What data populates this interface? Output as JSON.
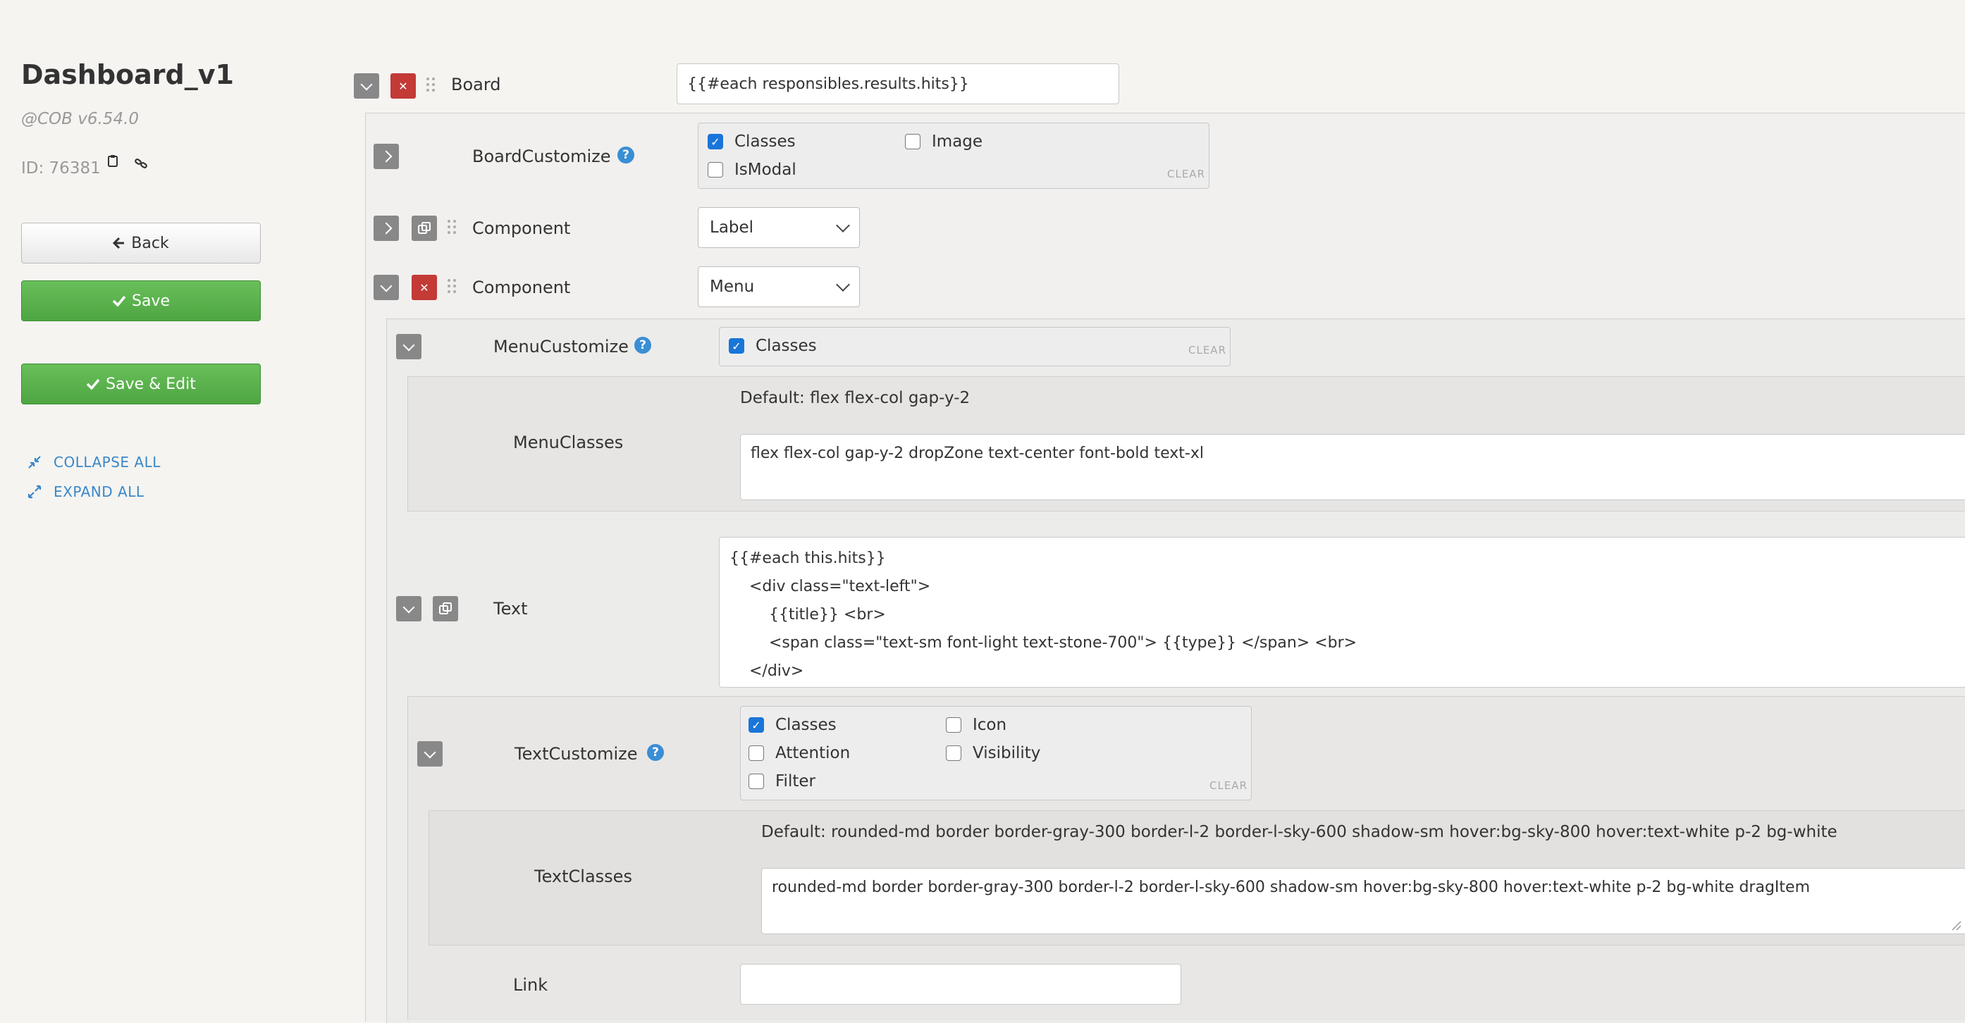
{
  "sidebar": {
    "title": "Dashboard_v1",
    "version": "@COB v6.54.0",
    "id_text": "ID: 76381",
    "copy_icon": "clipboard-icon",
    "link_icon": "link-icon",
    "back_label": "Back",
    "save_label": "Save",
    "save_edit_label": "Save & Edit",
    "collapse_all": "COLLAPSE ALL",
    "expand_all": "EXPAND ALL"
  },
  "form": {
    "board": {
      "label": "Board",
      "value": "{{#each responsibles.results.hits}}"
    },
    "board_customize": {
      "label": "BoardCustomize",
      "options": [
        {
          "label": "Classes",
          "checked": true
        },
        {
          "label": "Image",
          "checked": false
        },
        {
          "label": "IsModal",
          "checked": false
        }
      ],
      "clear": "CLEAR"
    },
    "component1": {
      "label": "Component",
      "value": "Label"
    },
    "component2": {
      "label": "Component",
      "value": "Menu"
    },
    "menu_customize": {
      "label": "MenuCustomize",
      "options": [
        {
          "label": "Classes",
          "checked": true
        }
      ],
      "clear": "CLEAR"
    },
    "menu_classes": {
      "label": "MenuClasses",
      "default": "Default: flex flex-col gap-y-2",
      "value": "flex flex-col gap-y-2 dropZone text-center font-bold text-xl"
    },
    "text": {
      "label": "Text",
      "lines": [
        "{{#each this.hits}}",
        "    <div class=\"text-left\">",
        "        {{title}} <br>",
        "        <span class=\"text-sm font-light text-stone-700\"> {{type}} </span> <br>",
        "    </div>"
      ]
    },
    "text_customize": {
      "label": "TextCustomize",
      "options": [
        {
          "label": "Classes",
          "checked": true
        },
        {
          "label": "Icon",
          "checked": false
        },
        {
          "label": "Attention",
          "checked": false
        },
        {
          "label": "Visibility",
          "checked": false
        },
        {
          "label": "Filter",
          "checked": false
        }
      ],
      "clear": "CLEAR"
    },
    "text_classes": {
      "label": "TextClasses",
      "default": "Default: rounded-md border border-gray-300 border-l-2 border-l-sky-600 shadow-sm hover:bg-sky-800 hover:text-white p-2 bg-white",
      "value": "rounded-md border border-gray-300 border-l-2 border-l-sky-600 shadow-sm hover:bg-sky-800 hover:text-white p-2 bg-white dragItem"
    },
    "link": {
      "label": "Link",
      "value": ""
    }
  }
}
